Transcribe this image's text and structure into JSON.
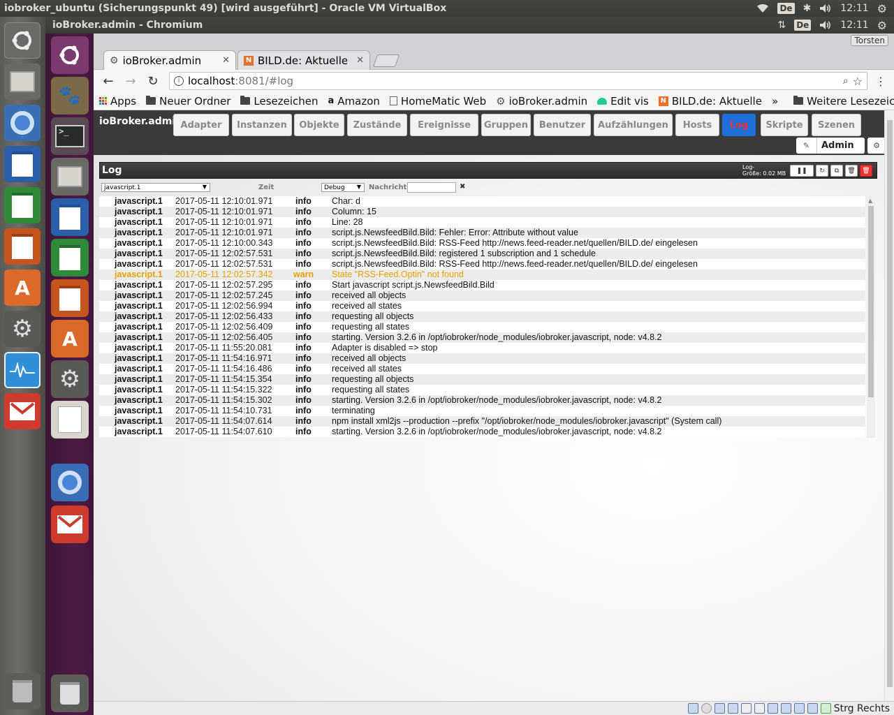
{
  "host": {
    "title": "iobroker_ubuntu (Sicherungspunkt 49) [wird ausgeführt] - Oracle VM VirtualBox",
    "keyboard": "De",
    "clock": "12:11"
  },
  "vm": {
    "title": "ioBroker.admin - Chromium",
    "keyboard": "De",
    "clock": "12:11",
    "status_text": "Strg Rechts"
  },
  "browser": {
    "tabs": [
      {
        "label": "ioBroker.admin",
        "icon": "gear-icon"
      },
      {
        "label": "BILD.de: Aktuelle N",
        "icon": "news-icon"
      }
    ],
    "user": "Torsten",
    "url_host": "localhost",
    "url_rest": ":8081/#log",
    "bookmarks": [
      {
        "label": "Apps",
        "icon": "apps-grid-icon"
      },
      {
        "label": "Neuer Ordner",
        "icon": "folder-icon"
      },
      {
        "label": "Lesezeichen",
        "icon": "folder-icon"
      },
      {
        "label": "Amazon",
        "icon": "amazon-icon"
      },
      {
        "label": "HomeMatic Web",
        "icon": "page-icon"
      },
      {
        "label": "ioBroker.admin",
        "icon": "gear-icon"
      },
      {
        "label": "Edit vis",
        "icon": "vis-icon"
      },
      {
        "label": "BILD.de: Aktuelle",
        "icon": "news-icon"
      }
    ],
    "overflow": "»",
    "other_bookmarks": "Weitere Lesezeichen"
  },
  "app": {
    "brand": "ioBroker.admin",
    "nav": [
      "Adapter",
      "Instanzen",
      "Objekte",
      "Zustände",
      "Ereignisse",
      "Gruppen",
      "Benutzer",
      "Aufzählungen",
      "Hosts",
      "Log",
      "Skripte",
      "Szenen"
    ],
    "active_nav": "Log",
    "user_button": "Admin"
  },
  "log": {
    "title": "Log",
    "size_label": "Log-",
    "size_value": "Größe: 0.02 MB",
    "filter_source": "javascript.1",
    "col_time": "Zeit",
    "filter_level": "Debug",
    "col_message": "Nachricht",
    "entries": [
      {
        "src": "javascript.1",
        "time": "2017-05-11 12:10:01.971",
        "sev": "info",
        "msg": "Char: d"
      },
      {
        "src": "javascript.1",
        "time": "2017-05-11 12:10:01.971",
        "sev": "info",
        "msg": "Column: 15"
      },
      {
        "src": "javascript.1",
        "time": "2017-05-11 12:10:01.971",
        "sev": "info",
        "msg": "Line: 28"
      },
      {
        "src": "javascript.1",
        "time": "2017-05-11 12:10:01.971",
        "sev": "info",
        "msg": "script.js.NewsfeedBild.Bild: Fehler: Error: Attribute without value"
      },
      {
        "src": "javascript.1",
        "time": "2017-05-11 12:10:00.343",
        "sev": "info",
        "msg": "script.js.NewsfeedBild.Bild: RSS-Feed http://news.feed-reader.net/quellen/BILD.de/ eingelesen"
      },
      {
        "src": "javascript.1",
        "time": "2017-05-11 12:02:57.531",
        "sev": "info",
        "msg": "script.js.NewsfeedBild.Bild: registered 1 subscription and 1 schedule"
      },
      {
        "src": "javascript.1",
        "time": "2017-05-11 12:02:57.531",
        "sev": "info",
        "msg": "script.js.NewsfeedBild.Bild: RSS-Feed http://news.feed-reader.net/quellen/BILD.de/ eingelesen"
      },
      {
        "src": "javascript.1",
        "time": "2017-05-11 12:02:57.342",
        "sev": "warn",
        "msg": "State \"RSS-Feed.Optin\" not found"
      },
      {
        "src": "javascript.1",
        "time": "2017-05-11 12:02:57.295",
        "sev": "info",
        "msg": "Start javascript script.js.NewsfeedBild.Bild"
      },
      {
        "src": "javascript.1",
        "time": "2017-05-11 12:02:57.245",
        "sev": "info",
        "msg": "received all objects"
      },
      {
        "src": "javascript.1",
        "time": "2017-05-11 12:02:56.994",
        "sev": "info",
        "msg": "received all states"
      },
      {
        "src": "javascript.1",
        "time": "2017-05-11 12:02:56.433",
        "sev": "info",
        "msg": "requesting all objects"
      },
      {
        "src": "javascript.1",
        "time": "2017-05-11 12:02:56.409",
        "sev": "info",
        "msg": "requesting all states"
      },
      {
        "src": "javascript.1",
        "time": "2017-05-11 12:02:56.405",
        "sev": "info",
        "msg": "starting. Version 3.2.6 in /opt/iobroker/node_modules/iobroker.javascript, node: v4.8.2"
      },
      {
        "src": "javascript.1",
        "time": "2017-05-11 11:55:20.081",
        "sev": "info",
        "msg": "Adapter is disabled => stop"
      },
      {
        "src": "javascript.1",
        "time": "2017-05-11 11:54:16.971",
        "sev": "info",
        "msg": "received all objects"
      },
      {
        "src": "javascript.1",
        "time": "2017-05-11 11:54:16.486",
        "sev": "info",
        "msg": "received all states"
      },
      {
        "src": "javascript.1",
        "time": "2017-05-11 11:54:15.354",
        "sev": "info",
        "msg": "requesting all objects"
      },
      {
        "src": "javascript.1",
        "time": "2017-05-11 11:54:15.322",
        "sev": "info",
        "msg": "requesting all states"
      },
      {
        "src": "javascript.1",
        "time": "2017-05-11 11:54:15.302",
        "sev": "info",
        "msg": "starting. Version 3.2.6 in /opt/iobroker/node_modules/iobroker.javascript, node: v4.8.2"
      },
      {
        "src": "javascript.1",
        "time": "2017-05-11 11:54:10.731",
        "sev": "info",
        "msg": "terminating"
      },
      {
        "src": "javascript.1",
        "time": "2017-05-11 11:54:07.614",
        "sev": "info",
        "msg": "npm install xml2js --production --prefix \"/opt/iobroker/node_modules/iobroker.javascript\" (System call)"
      },
      {
        "src": "javascript.1",
        "time": "2017-05-11 11:54:07.610",
        "sev": "info",
        "msg": "starting. Version 3.2.6 in /opt/iobroker/node_modules/iobroker.javascript, node: v4.8.2"
      }
    ]
  },
  "colors": {
    "warn": "#e8a000",
    "active_tab": "#1e6fd9",
    "active_tab_text": "#ee3333",
    "delete": "#ee3333"
  }
}
